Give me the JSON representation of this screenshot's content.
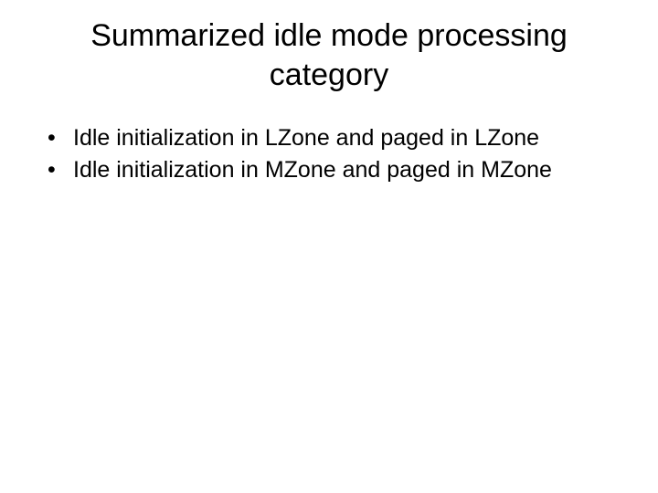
{
  "title": "Summarized idle mode processing category",
  "bullets": [
    "Idle initialization in LZone and paged in LZone",
    "Idle initialization in MZone and paged in MZone"
  ]
}
